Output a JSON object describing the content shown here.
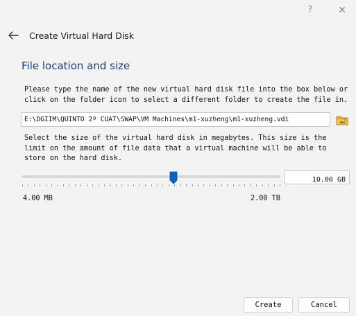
{
  "titlebar": {
    "help_glyph": "?",
    "close_glyph": "✕"
  },
  "header": {
    "title": "Create Virtual Hard Disk",
    "back_icon": "arrow-left-icon"
  },
  "section": {
    "title": "File location and size"
  },
  "location": {
    "description": "Please type the name of the new virtual hard disk file into the box below or click on the folder icon to select a different folder to create the file in.",
    "path_value": "E:\\DGIIM\\QUINTO 2º CUAT\\SWAP\\VM Machines\\m1-xuzheng\\m1-xuzheng.vdi",
    "folder_icon": "folder-browse-icon"
  },
  "size": {
    "description": "Select the size of the virtual hard disk in megabytes. This size is the limit on the amount of file data that a virtual machine will be able to store on the hard disk.",
    "value_text": "10.00 GB",
    "slider_fraction": 0.586,
    "min_label": "4.00 MB",
    "max_label": "2.00 TB"
  },
  "buttons": {
    "create_label": "Create",
    "cancel_label": "Cancel"
  },
  "colors": {
    "section_title": "#1c3f80",
    "slider_thumb": "#0067c0"
  }
}
